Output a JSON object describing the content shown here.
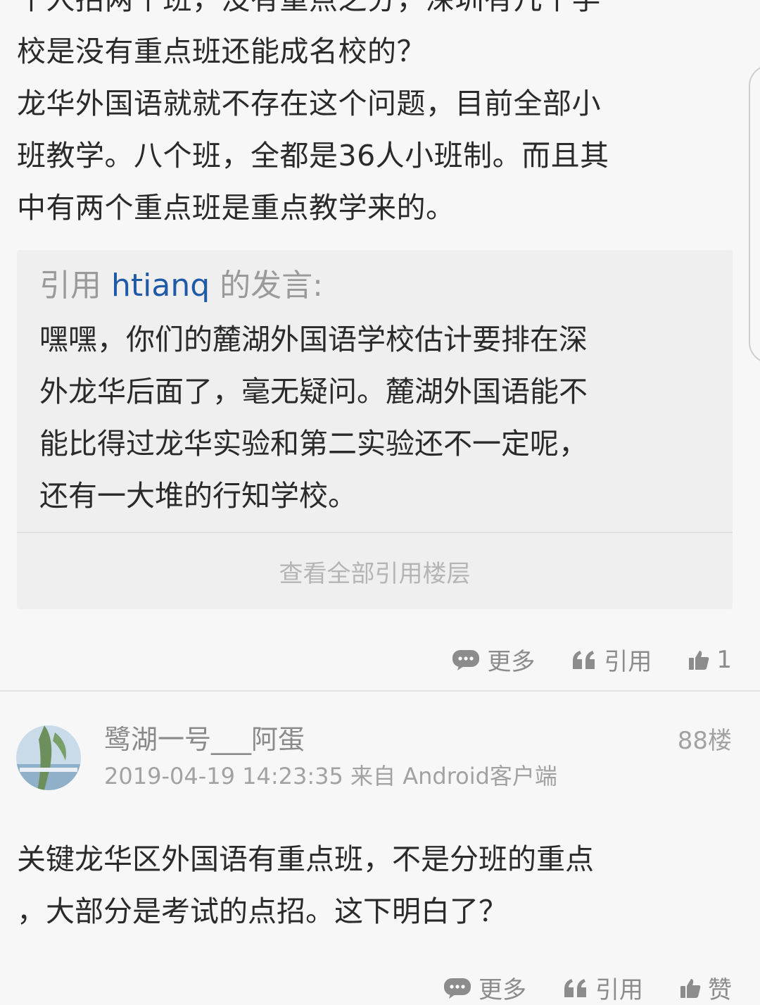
{
  "post": {
    "text": "个人招两个班，没有重点之分，深圳有几个学\n校是没有重点班还能成名校的？\n龙华外国语就就不存在这个问题，目前全部小\n班教学。八个班，全都是36人小班制。而且其\n中有两个重点班是重点教学来的。"
  },
  "quote": {
    "prefix": "引用 ",
    "user": "htianq",
    "suffix": " 的发言:",
    "text": "嘿嘿，你们的麓湖外国语学校估计要排在深\n外龙华后面了，毫无疑问。麓湖外国语能不\n能比得过龙华实验和第二实验还不一定呢，\n还有一大堆的行知学校。",
    "view_all_label": "查看全部引用楼层"
  },
  "actions": {
    "more_label": "更多",
    "quote_label": "引用",
    "like_count": "1",
    "like_label": "赞"
  },
  "reply": {
    "username": "鹭湖一号___阿蛋",
    "timestamp": "2019-04-19 14:23:35",
    "source": "来自 Android客户端",
    "floor": "88楼",
    "text": "关键龙华区外国语有重点班，不是分班的重点\n，大部分是考试的点招。这下明白了？"
  },
  "colors": {
    "background": "#f7f7f7",
    "quote_background": "#efefef",
    "link_blue": "#1f5aa6",
    "muted_gray": "#8c8c8c"
  },
  "icons": {
    "more": "speech-bubble-dots-icon",
    "quote": "quote-marks-icon",
    "like": "thumbs-up-icon"
  }
}
